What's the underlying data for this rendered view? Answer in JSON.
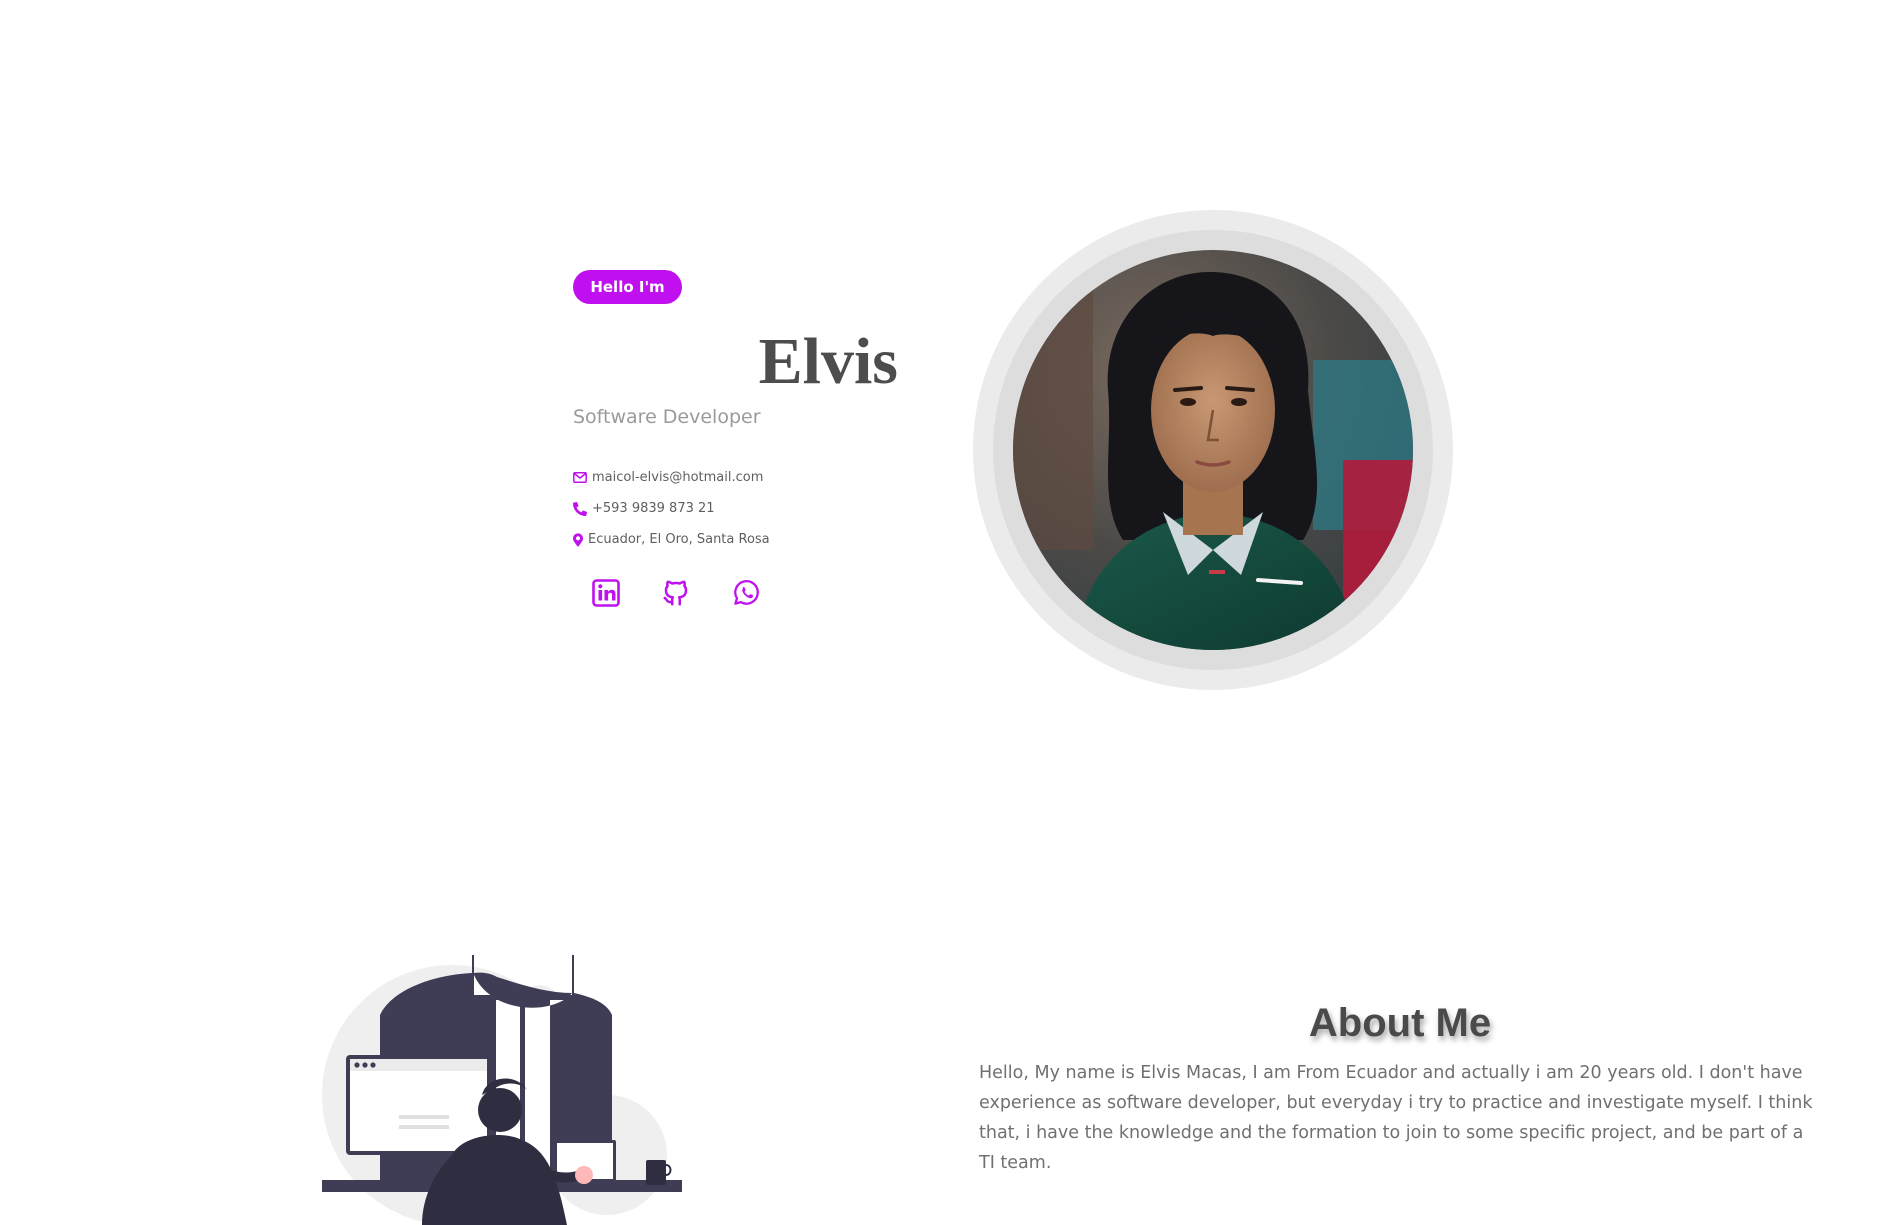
{
  "hero": {
    "badge": "Hello I'm",
    "name": "Elvis",
    "role": "Software Developer",
    "contacts": [
      {
        "icon": "envelope-icon",
        "text": "maicol-elvis@hotmail.com"
      },
      {
        "icon": "phone-icon",
        "text": "+593 9839 873 21"
      },
      {
        "icon": "map-pin-icon",
        "text": "Ecuador, El Oro, Santa Rosa"
      }
    ],
    "social": [
      {
        "icon": "linkedin-icon"
      },
      {
        "icon": "github-icon"
      },
      {
        "icon": "whatsapp-icon"
      }
    ]
  },
  "about": {
    "title": "About Me",
    "paragraph": "Hello, My name is Elvis Macas, I am From Ecuador and actually i am 20 years old. I don't have experience as software developer, but everyday i try to practice and investigate myself. I think that, i have the knowledge and the formation to join to some specific project, and be part of a TI team."
  },
  "colors": {
    "accent": "#c010f0",
    "heading": "#4d4d4d",
    "muted": "#9a9a9a",
    "body_text": "#707070"
  }
}
